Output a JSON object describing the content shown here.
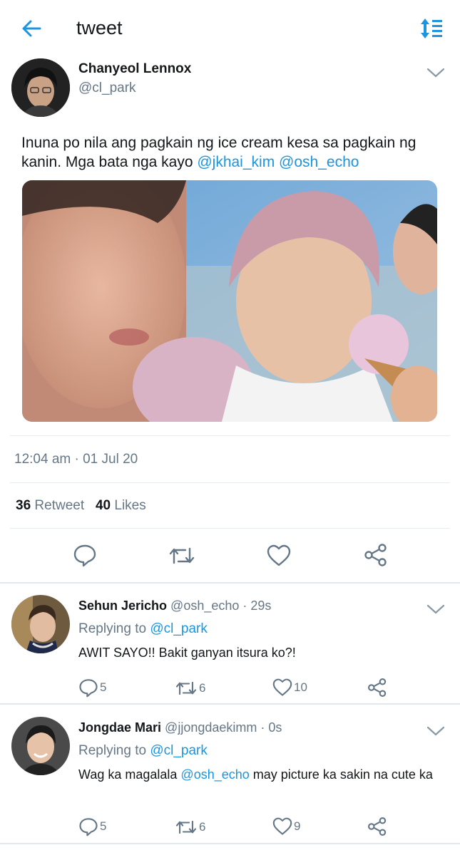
{
  "header": {
    "title": "tweet",
    "back_icon": "back-arrow-icon",
    "sort_icon": "sort-icon",
    "accent": "#1b95e0"
  },
  "tweet": {
    "author_name": "Chanyeol Lennox",
    "author_handle": "@cl_park",
    "text_plain": "Inuna po nila ang pagkain ng ice cream kesa sa pagkain ng kanin. Mga bata nga kayo",
    "mention1": "@jkhai_kim",
    "mention2": "@osh_echo",
    "timestamp": "12:04 am · 01 Jul 20",
    "retweet_count": "36",
    "retweet_label": "Retweet",
    "like_count": "40",
    "like_label": "Likes"
  },
  "replies": [
    {
      "name": "Sehun Jericho",
      "meta": "@osh_echo · 29s",
      "replying_label": "Replying to",
      "replying_handle": "@cl_park",
      "text_before": "AWIT SAYO!! Bakit ganyan itsura ko?!",
      "replies": "5",
      "retweets": "6",
      "likes": "10"
    },
    {
      "name": "Jongdae Mari",
      "meta": "@jjongdaekimm · 0s",
      "replying_label": "Replying to",
      "replying_handle": "@cl_park",
      "text_before": "Wag ka magalala",
      "mention": "@osh_echo",
      "text_after": "may picture ka sakin na cute ka",
      "replies": "5",
      "retweets": "6",
      "likes": "9"
    }
  ]
}
